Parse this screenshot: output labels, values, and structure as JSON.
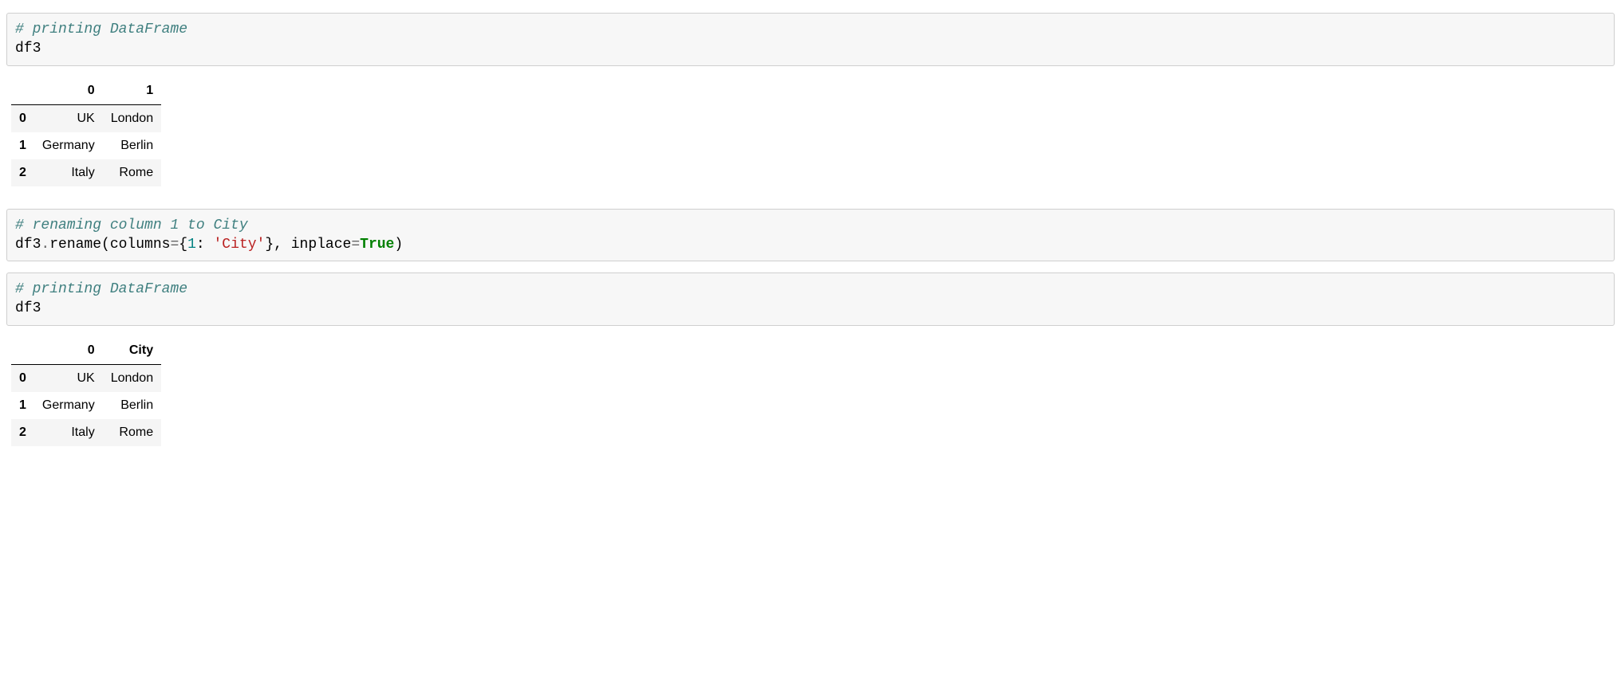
{
  "cell1": {
    "comment": "# printing DataFrame",
    "code": "df3"
  },
  "df1": {
    "columns": [
      "0",
      "1"
    ],
    "index": [
      "0",
      "1",
      "2"
    ],
    "rows": [
      [
        "UK",
        "London"
      ],
      [
        "Germany",
        "Berlin"
      ],
      [
        "Italy",
        "Rome"
      ]
    ]
  },
  "cell2": {
    "comment": "# renaming column 1 to City",
    "code_pre": "df3",
    "dot": ".",
    "rename": "rename(columns",
    "eq1": "=",
    "brace_open": "{",
    "num": "1",
    "colon": ": ",
    "str": "'City'",
    "brace_close": "}, inplace",
    "eq2": "=",
    "kw": "True",
    "close": ")"
  },
  "cell3": {
    "comment": "# printing DataFrame",
    "code": "df3"
  },
  "df2": {
    "columns": [
      "0",
      "City"
    ],
    "index": [
      "0",
      "1",
      "2"
    ],
    "rows": [
      [
        "UK",
        "London"
      ],
      [
        "Germany",
        "Berlin"
      ],
      [
        "Italy",
        "Rome"
      ]
    ]
  }
}
